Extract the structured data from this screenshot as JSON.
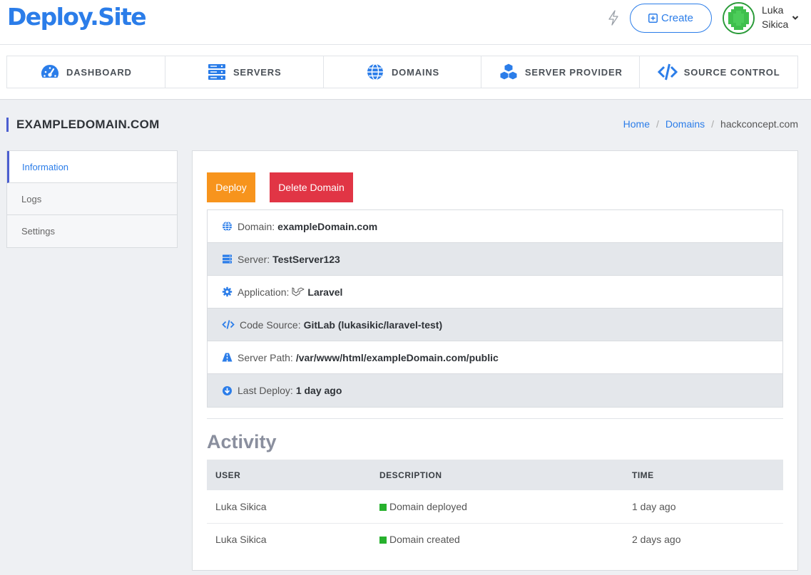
{
  "header": {
    "logo": "Deploy.Site",
    "create_label": "Create",
    "user": {
      "first_name": "Luka",
      "last_name": "Sikica"
    }
  },
  "nav": {
    "items": [
      {
        "label": "DASHBOARD",
        "icon": "speedometer-icon"
      },
      {
        "label": "SERVERS",
        "icon": "server-icon"
      },
      {
        "label": "DOMAINS",
        "icon": "globe-icon"
      },
      {
        "label": "SERVER PROVIDER",
        "icon": "cubes-icon"
      },
      {
        "label": "SOURCE CONTROL",
        "icon": "code-icon"
      }
    ]
  },
  "page": {
    "title": "EXAMPLEDOMAIN.COM",
    "breadcrumb": {
      "home": "Home",
      "domains": "Domains",
      "current": "hackconcept.com"
    }
  },
  "side_menu": {
    "items": [
      {
        "label": "Information",
        "active": true
      },
      {
        "label": "Logs",
        "active": false
      },
      {
        "label": "Settings",
        "active": false
      }
    ]
  },
  "actions": {
    "deploy": "Deploy",
    "delete": "Delete Domain"
  },
  "info": {
    "domain": {
      "label": "Domain:",
      "value": "exampleDomain.com",
      "icon": "globe-icon"
    },
    "server": {
      "label": "Server:",
      "value": "TestServer123",
      "icon": "server-icon"
    },
    "application": {
      "label": "Application:",
      "value": "Laravel",
      "icon": "gear-icon"
    },
    "code_source": {
      "label": "Code Source:",
      "value": "GitLab (lukasikic/laravel-test)",
      "icon": "code-icon"
    },
    "server_path": {
      "label": "Server Path:",
      "value": "/var/www/html/exampleDomain.com/public",
      "icon": "road-icon"
    },
    "last_deploy": {
      "label": "Last Deploy:",
      "value": "1 day ago",
      "icon": "download-circle-icon"
    }
  },
  "activity": {
    "title": "Activity",
    "columns": {
      "user": "USER",
      "description": "DESCRIPTION",
      "time": "TIME"
    },
    "rows": [
      {
        "user": "Luka Sikica",
        "description": "Domain deployed",
        "time": "1 day ago"
      },
      {
        "user": "Luka Sikica",
        "description": "Domain created",
        "time": "2 days ago"
      }
    ]
  },
  "colors": {
    "accent": "#2b7de9",
    "deploy": "#f7941d",
    "delete": "#e13545",
    "status_green": "#27b12d",
    "active_border": "#4b5ed0"
  }
}
